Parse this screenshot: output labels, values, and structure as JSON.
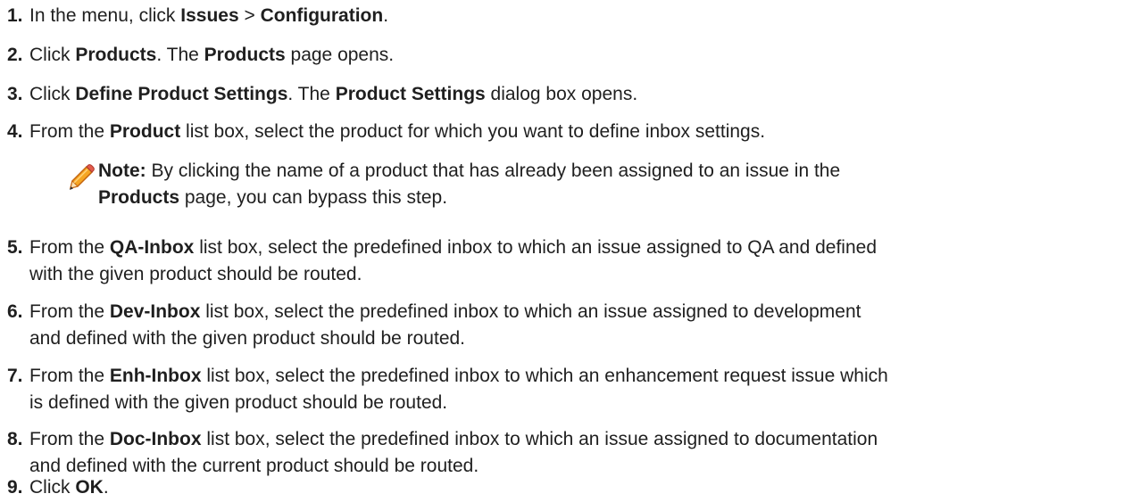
{
  "steps": [
    {
      "number": "1.",
      "parts": [
        "In the menu, click ",
        "Issues",
        " > ",
        "Configuration",
        "."
      ]
    },
    {
      "number": "2.",
      "parts": [
        "Click ",
        "Products",
        ". The ",
        "Products",
        " page opens."
      ]
    },
    {
      "number": "3.",
      "parts": [
        "Click ",
        "Define Product Settings",
        ". The ",
        "Product Settings",
        " dialog box opens."
      ]
    },
    {
      "number": "4.",
      "parts": [
        "From the ",
        "Product",
        " list box, select the product for which you want to define inbox settings."
      ]
    },
    {
      "number": "5.",
      "parts": [
        "From the ",
        "QA-Inbox",
        " list box, select the predefined inbox to which an issue assigned to QA and defined",
        "with the given product should be routed."
      ]
    },
    {
      "number": "6.",
      "parts": [
        "From the ",
        "Dev-Inbox",
        " list box, select the predefined inbox to which an issue assigned to development",
        "and defined with the given product should be routed."
      ]
    },
    {
      "number": "7.",
      "parts": [
        "From the ",
        "Enh-Inbox",
        " list box, select the predefined inbox to which an enhancement request issue which",
        "is defined with the given product should be routed."
      ]
    },
    {
      "number": "8.",
      "parts": [
        "From the ",
        "Doc-Inbox",
        " list box, select the predefined inbox to which an issue assigned to documentation",
        "and defined with the current product should be routed."
      ]
    },
    {
      "number": "9.",
      "parts": [
        "Click ",
        "OK",
        "."
      ]
    }
  ],
  "note": {
    "icon": "pencil-icon",
    "label": "Note:",
    "line1": " By clicking the name of a product that has already been assigned to an issue in the",
    "bold": "Products",
    "line2": " page, you can bypass this step."
  }
}
